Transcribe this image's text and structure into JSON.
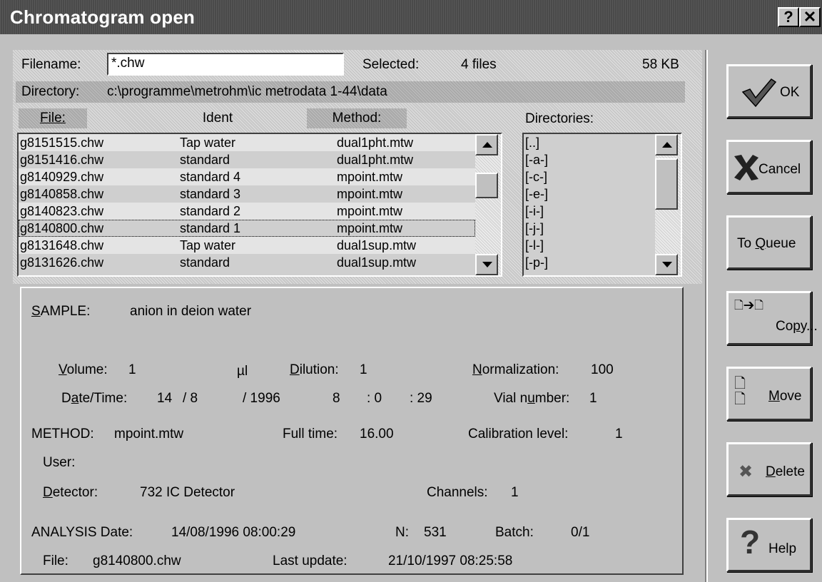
{
  "window": {
    "title": "Chromatogram open",
    "help_glyph": "?",
    "close_glyph": "✕"
  },
  "top": {
    "filename_label": "Filename:",
    "filename_value": "*.chw",
    "selected_label": "Selected:",
    "selected_count": "4 files",
    "selected_size": "58 KB",
    "directory_label": "Directory:",
    "directory_value": "c:\\programme\\metrohm\\ic metrodata 1-44\\data"
  },
  "file_list": {
    "headers": {
      "file": "File:",
      "ident": "Ident",
      "method": "Method:"
    },
    "rows": [
      {
        "file": "g8151515.chw",
        "ident": "Tap water",
        "method": "dual1pht.mtw"
      },
      {
        "file": "g8151416.chw",
        "ident": "standard",
        "method": "dual1pht.mtw"
      },
      {
        "file": "g8140929.chw",
        "ident": "standard 4",
        "method": "mpoint.mtw"
      },
      {
        "file": "g8140858.chw",
        "ident": "standard 3",
        "method": "mpoint.mtw"
      },
      {
        "file": "g8140823.chw",
        "ident": "standard 2",
        "method": "mpoint.mtw"
      },
      {
        "file": "g8140800.chw",
        "ident": "standard 1",
        "method": "mpoint.mtw"
      },
      {
        "file": "g8131648.chw",
        "ident": "Tap water",
        "method": "dual1sup.mtw"
      },
      {
        "file": "g8131626.chw",
        "ident": "standard",
        "method": "dual1sup.mtw"
      }
    ]
  },
  "directories": {
    "label": "Directories:",
    "items": [
      "[..]",
      "[-a-]",
      "[-c-]",
      "[-e-]",
      "[-i-]",
      "[-j-]",
      "[-l-]",
      "[-p-]"
    ]
  },
  "details": {
    "sample_label": "SAMPLE:",
    "sample_value": "anion in deion water",
    "volume_label": "Volume:",
    "volume_value": "1",
    "volume_unit": "µl",
    "dilution_label": "Dilution:",
    "dilution_value": "1",
    "normalization_label": "Normalization:",
    "normalization_value": "100",
    "datetime_label": "Date/Time:",
    "date_day": "14",
    "date_month": "/ 8",
    "date_year": "/ 1996",
    "time_hour": "8",
    "time_min": ": 0",
    "time_sec": ": 29",
    "vial_label": "Vial number:",
    "vial_value": "1",
    "method_label": "METHOD:",
    "method_value": "mpoint.mtw",
    "fulltime_label": "Full time:",
    "fulltime_value": "16.00",
    "calib_label": "Calibration level:",
    "calib_value": "1",
    "user_label": "User:",
    "detector_label": "Detector:",
    "detector_value": "732 IC Detector",
    "channels_label": "Channels:",
    "channels_value": "1",
    "analysis_label": "ANALYSIS  Date:",
    "analysis_value": "14/08/1996 08:00:29",
    "n_label": "N:",
    "n_value": "531",
    "batch_label": "Batch:",
    "batch_value": "0/1",
    "file_label": "File:",
    "file_value": "g8140800.chw",
    "lastupdate_label": "Last update:",
    "lastupdate_value": "21/10/1997 08:25:58"
  },
  "buttons": {
    "ok": "OK",
    "cancel": "Cancel",
    "to_queue": "To Queue",
    "copy": "Copy...",
    "move": "Move",
    "delete": "Delete",
    "help": "Help"
  }
}
